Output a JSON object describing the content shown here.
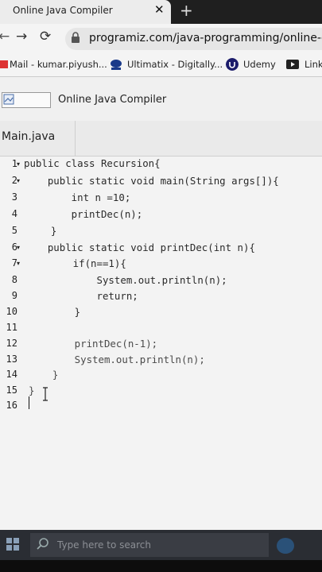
{
  "browser": {
    "tab_title": "Online Java Compiler",
    "tab_close": "✕",
    "new_tab": "+",
    "url": "programiz.com/java-programming/online-comp",
    "nav": {
      "back": "←",
      "forward": "→",
      "reload": "⟳"
    }
  },
  "bookmarks": [
    {
      "label": "Mail - kumar.piyush..."
    },
    {
      "label": "Ultimatix - Digitally..."
    },
    {
      "label": "Udemy"
    },
    {
      "label": "Link"
    }
  ],
  "site": {
    "title": "Online Java Compiler"
  },
  "editor": {
    "file_tab": "Main.java",
    "line_numbers": [
      "1",
      "2",
      "3",
      "4",
      "5",
      "6",
      "7",
      "8",
      "9",
      "10",
      "11",
      "12",
      "13",
      "14",
      "15",
      "16"
    ],
    "fold_marker": "▾",
    "lines": [
      "public class Recursion{",
      "    public static void main(String args[]){",
      "        int n =10;",
      "        printDec(n);",
      "    }",
      "    public static void printDec(int n){",
      "        if(n==1){",
      "            System.out.println(n);",
      "            return;",
      "        }",
      "",
      "        printDec(n-1);",
      "        System.out.println(n);",
      "    }",
      "}",
      ""
    ]
  },
  "taskbar": {
    "search_placeholder": "Type here to search"
  },
  "colors": {
    "keyword": "#1d2a8a",
    "taskbar": "#2a2d33",
    "tab_bar": "#1f1f1f"
  }
}
